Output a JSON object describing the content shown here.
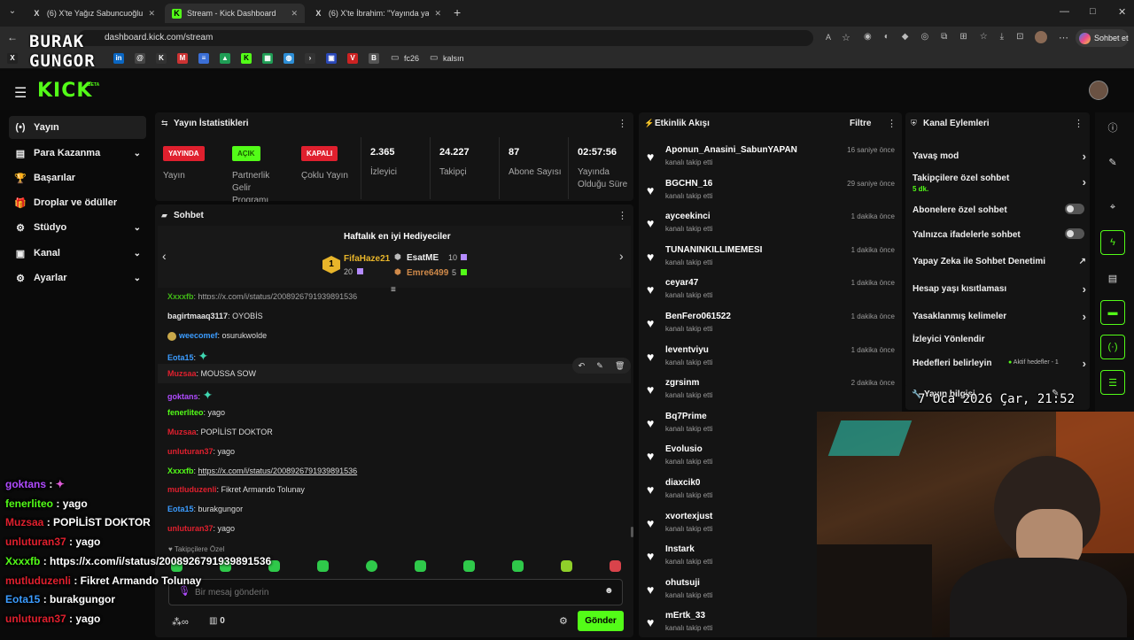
{
  "browser": {
    "tabs": [
      {
        "icon": "X",
        "title": "(6) X'te Yağız Sabuncuoğlu: \"🤠🚀..."
      },
      {
        "icon": "K",
        "title": "Stream - Kick Dashboard"
      },
      {
        "icon": "X",
        "title": "(6) X'te İbrahim: \"Yayında yaptığım..."
      }
    ],
    "url": "dashboard.kick.com/stream",
    "copilot_label": "Sohbet et",
    "bookmark_folders": [
      "fc26",
      "kalsın"
    ],
    "window_controls": [
      "—",
      "□",
      "✕"
    ]
  },
  "watermark": {
    "line1": "BURAK",
    "line2": "GUNGOR"
  },
  "header": {
    "logo": "KICK",
    "beta": "BETA"
  },
  "sidebar": {
    "items": [
      {
        "icon": "(•)",
        "label": "Yayın",
        "chevron": false
      },
      {
        "icon": "▤",
        "label": "Para Kazanma",
        "chevron": true
      },
      {
        "icon": "🏆",
        "label": "Başarılar",
        "chevron": false
      },
      {
        "icon": "🎁",
        "label": "Droplar ve ödüller",
        "chevron": false
      },
      {
        "icon": "⚙",
        "label": "Stüdyo",
        "chevron": true
      },
      {
        "icon": "▣",
        "label": "Kanal",
        "chevron": true
      },
      {
        "icon": "⚙",
        "label": "Ayarlar",
        "chevron": true
      }
    ]
  },
  "stats": {
    "title": "Yayın İstatistikleri",
    "badges": [
      {
        "text": "YAYINDA",
        "label": "Yayın",
        "color": "#e0202e"
      },
      {
        "text": "AÇIK",
        "label": "Partnerlik Gelir Programı",
        "color": "#53fc18"
      },
      {
        "text": "KAPALI",
        "label": "Çoklu Yayın",
        "color": "#e0202e"
      }
    ],
    "values": [
      {
        "value": "2.365",
        "label": "İzleyici"
      },
      {
        "value": "24.227",
        "label": "Takipçi"
      },
      {
        "value": "87",
        "label": "Abone Sayısı"
      },
      {
        "value": "02:57:56",
        "label": "Yayında Olduğu Süre"
      }
    ]
  },
  "chat": {
    "title": "Sohbet",
    "gifters_title": "Haftalık en iyi Hediyeciler",
    "gifters": [
      {
        "rank": "1",
        "name": "FifaHaze21",
        "count": "20"
      },
      {
        "name": "EsatME",
        "count": "10"
      },
      {
        "name": "Emre6499",
        "count": "5"
      }
    ],
    "messages": [
      {
        "user": "Xxxxfb",
        "text": "https://x.com/i/status/2008926791939891536",
        "color": "#53fc18",
        "link": true
      },
      {
        "user": "bagirtmaaq3117",
        "text": "OYOBİS",
        "color": "#e6e6e6"
      },
      {
        "user": "weecomef",
        "text": "osurukwolde",
        "color": "#3b9cff"
      },
      {
        "user": "Eota15",
        "text": "",
        "color": "#3b9cff",
        "emote": true
      },
      {
        "user": "Muzsaa",
        "text": "MOUSSA SOW",
        "color": "#e0202e"
      },
      {
        "user": "goktans",
        "text": "",
        "color": "#b04bff",
        "emote": true
      },
      {
        "user": "fenerliteo",
        "text": "yago",
        "color": "#53fc18"
      },
      {
        "user": "Muzsaa",
        "text": "POPİLİST DOKTOR",
        "color": "#e0202e"
      },
      {
        "user": "unluturan37",
        "text": "yago",
        "color": "#e0202e"
      },
      {
        "user": "Xxxxfb",
        "text": "https://x.com/i/status/2008926791939891536",
        "color": "#53fc18",
        "link": true
      },
      {
        "user": "mutluduzenli",
        "text": "Fikret Armando Tolunay",
        "color": "#e0202e"
      },
      {
        "user": "Eota15",
        "text": "burakgungor",
        "color": "#3b9cff"
      },
      {
        "user": "unluturan37",
        "text": "yago",
        "color": "#e0202e"
      }
    ],
    "followers_only": "Takipçilere Özel",
    "input_placeholder": "Bir mesaj gönderin",
    "send_label": "Gönder",
    "points": "∞",
    "gifts": "0"
  },
  "events": {
    "title": "Etkinlik Akışı",
    "filter_label": "Filtre",
    "items": [
      {
        "name": "Aponun_Anasini_SabunYAPAN",
        "action": "kanalı takip etti",
        "time": "16 saniye önce"
      },
      {
        "name": "BGCHN_16",
        "action": "kanalı takip etti",
        "time": "29 saniye önce"
      },
      {
        "name": "ayceekinci",
        "action": "kanalı takip etti",
        "time": "1 dakika önce"
      },
      {
        "name": "TUNANINKILLIMEMESI",
        "action": "kanalı takip etti",
        "time": "1 dakika önce"
      },
      {
        "name": "ceyar47",
        "action": "kanalı takip etti",
        "time": "1 dakika önce"
      },
      {
        "name": "BenFero061522",
        "action": "kanalı takip etti",
        "time": "1 dakika önce"
      },
      {
        "name": "leventviyu",
        "action": "kanalı takip etti",
        "time": "1 dakika önce"
      },
      {
        "name": "zgrsinm",
        "action": "kanalı takip etti",
        "time": "2 dakika önce"
      },
      {
        "name": "Bq7Prime",
        "action": "kanalı takip etti",
        "time": ""
      },
      {
        "name": "Evolusio",
        "action": "kanalı takip etti",
        "time": ""
      },
      {
        "name": "diaxcik0",
        "action": "kanalı takip etti",
        "time": ""
      },
      {
        "name": "xvortexjust",
        "action": "kanalı takip etti",
        "time": ""
      },
      {
        "name": "Instark",
        "action": "kanalı takip etti",
        "time": ""
      },
      {
        "name": "ohutsuji",
        "action": "kanalı takip etti",
        "time": ""
      },
      {
        "name": "mErtk_33",
        "action": "kanalı takip etti",
        "time": ""
      }
    ]
  },
  "channel_actions": {
    "title": "Kanal Eylemleri",
    "items": [
      {
        "label": "Yavaş mod",
        "control": "chevron"
      },
      {
        "label": "Takipçilere özel sohbet",
        "sub": "5 dk.",
        "control": "chevron"
      },
      {
        "label": "Abonelere özel sohbet",
        "control": "toggle"
      },
      {
        "label": "Yalnızca ifadelerle sohbet",
        "control": "toggle"
      },
      {
        "label": "Yapay Zeka ile Sohbet Denetimi",
        "control": "external"
      },
      {
        "label": "Hesap yaşı kısıtlaması",
        "control": "chevron"
      },
      {
        "label": "Yasaklanmış kelimeler",
        "control": "chevron"
      },
      {
        "label": "İzleyici Yönlendir",
        "control": "none"
      },
      {
        "label": "Hedefleri belirleyin",
        "status": "Aktif hedefler - 1",
        "control": "chevron"
      }
    ],
    "stream_info_title": "Yayın bilgisi"
  },
  "clock": "7 Oca 2026 Çar, 21:52",
  "overlay_chat": [
    {
      "user": "goktans",
      "text": "",
      "color": "#b04bff",
      "emote": true
    },
    {
      "user": "fenerliteo",
      "text": "yago",
      "color": "#53fc18"
    },
    {
      "user": "Muzsaa",
      "text": "POPİLİST DOKTOR",
      "color": "#e0202e"
    },
    {
      "user": "unluturan37",
      "text": "yago",
      "color": "#e0202e"
    },
    {
      "user": "Xxxxfb",
      "text": "https://x.com/i/status/2008926791939891536",
      "color": "#53fc18"
    },
    {
      "user": "mutluduzenli",
      "text": "Fikret Armando Tolunay",
      "color": "#e0202e"
    },
    {
      "user": "Eota15",
      "text": "burakgungor",
      "color": "#3b9cff"
    },
    {
      "user": "unluturan37",
      "text": "yago",
      "color": "#e0202e"
    }
  ]
}
